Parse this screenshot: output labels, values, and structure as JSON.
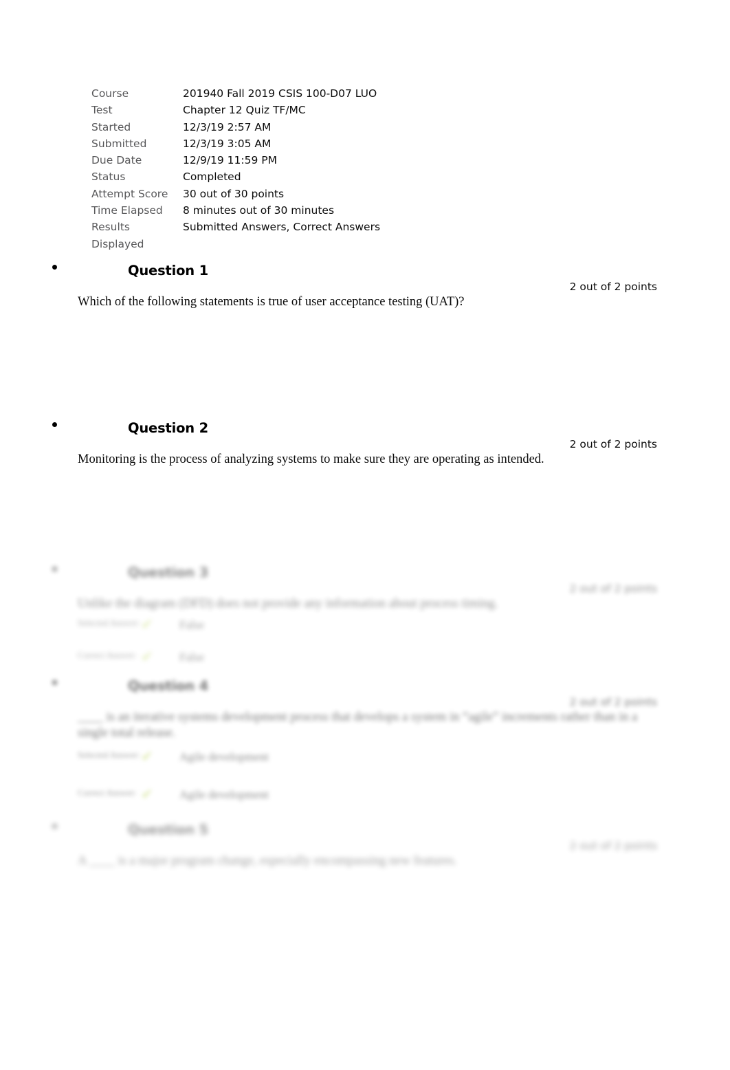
{
  "attempt_summary": {
    "rows": [
      {
        "label": "Course",
        "value": "201940 Fall 2019 CSIS 100-D07 LUO"
      },
      {
        "label": "Test",
        "value": "Chapter 12 Quiz TF/MC"
      },
      {
        "label": "Started",
        "value": "12/3/19 2:57 AM"
      },
      {
        "label": "Submitted",
        "value": "12/3/19 3:05 AM"
      },
      {
        "label": "Due Date",
        "value": "12/9/19 11:59 PM"
      },
      {
        "label": "Status",
        "value": "Completed"
      },
      {
        "label": "Attempt Score",
        "value": "30 out of 30 points"
      },
      {
        "label": "Time Elapsed",
        "value": "8 minutes out of 30 minutes"
      },
      {
        "label": "Results Displayed",
        "value": "Submitted Answers, Correct Answers"
      }
    ]
  },
  "questions": [
    {
      "title": "Question 1",
      "points": "2 out of 2 points",
      "text": "Which of the following statements is true of user acceptance testing (UAT)?",
      "answers": []
    },
    {
      "title": "Question 2",
      "points": "2 out of 2 points",
      "text": "Monitoring is the process of analyzing systems to make sure they are operating as intended.",
      "answers": []
    },
    {
      "title": "Question 3",
      "points": "2 out of 2 points",
      "text": "Unlike the diagram (DFD) does not provide any information about process timing.",
      "answers": [
        {
          "label": "Selected Answer:",
          "mark": "✔",
          "text": "False"
        },
        {
          "label": "Correct Answer:",
          "mark": "✔",
          "text": "False"
        }
      ]
    },
    {
      "title": "Question 4",
      "points": "2 out of 2 points",
      "text": "____ is an iterative systems development process that develops a system in “agile” increments rather than in a single total release.",
      "answers": [
        {
          "label": "Selected Answer:",
          "mark": "✔",
          "text": "Agile development"
        },
        {
          "label": "Correct Answer:",
          "mark": "✔",
          "text": "Agile development"
        }
      ]
    },
    {
      "title": "Question 5",
      "points": "2 out of 2 points",
      "text": "A ____ is a major program change, especially encompassing new features.",
      "answers": []
    }
  ],
  "colors": {
    "label_gray": "#58585a",
    "text_black": "#0b0b0b",
    "check_green": "#c3d96b",
    "page_background": "#ffffff"
  }
}
